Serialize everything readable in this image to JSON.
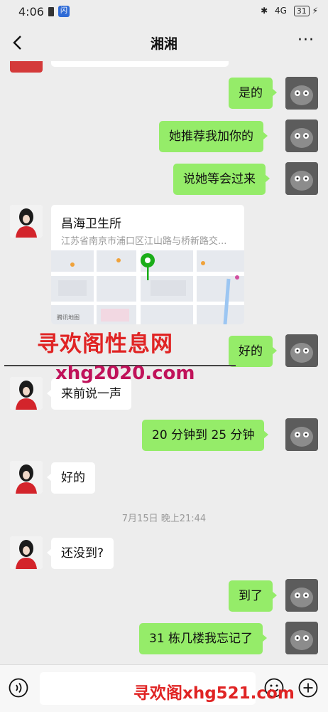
{
  "status_bar": {
    "time": "4:06",
    "app_icon_text": "闪",
    "network": "4G",
    "battery": "31"
  },
  "header": {
    "title": "湘湘",
    "more": "···"
  },
  "messages": [
    {
      "side": "right",
      "text": "是的"
    },
    {
      "side": "right",
      "text": "她推荐我加你的"
    },
    {
      "side": "right",
      "text": "说她等会过来"
    },
    {
      "side": "left",
      "type": "location",
      "title": "昌海卫生所",
      "address": "江苏省南京市浦口区江山路与桥新路交..."
    },
    {
      "side": "right",
      "text": "好的"
    },
    {
      "side": "left",
      "text": "来前说一声"
    },
    {
      "side": "right",
      "text": "20 分钟到 25 分钟"
    },
    {
      "side": "left",
      "text": "好的"
    },
    {
      "side": "left",
      "text": "还没到?"
    },
    {
      "side": "right",
      "text": "到了"
    },
    {
      "side": "right",
      "text": "31 栋几楼我忘记了"
    }
  ],
  "timestamp": "7月15日 晚上21:44",
  "map_credit": "腾讯地图",
  "watermarks": {
    "top": "寻欢阁性息网",
    "middle": "xhg2020.com",
    "bottom": "寻欢阁xhg521.com"
  },
  "colors": {
    "sent_bubble": "#95ec69",
    "received_bubble": "#ffffff",
    "background": "#ededed",
    "map_pin": "#1aad19"
  },
  "icons": [
    "back-icon",
    "more-icon",
    "voice-icon",
    "emoji-icon",
    "plus-icon",
    "map-pin-icon"
  ]
}
